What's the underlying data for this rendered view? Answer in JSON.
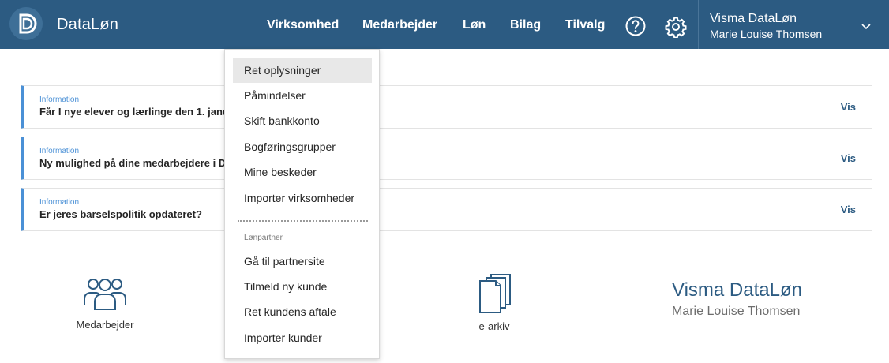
{
  "header": {
    "brand": "DataLøn",
    "nav": [
      "Virksomhed",
      "Medarbejder",
      "Løn",
      "Bilag",
      "Tilvalg"
    ],
    "help_icon": "question-circle-icon",
    "settings_icon": "gear-icon",
    "user": {
      "company": "Visma DataLøn",
      "name": "Marie Louise Thomsen",
      "chevron_icon": "chevron-down-icon"
    },
    "colors": {
      "bar": "#2c5b82",
      "text": "#ffffff"
    }
  },
  "info_cards": [
    {
      "kicker": "Information",
      "title": "Får I nye elever og lærlinge den 1. janu",
      "link": "Vis"
    },
    {
      "kicker": "Information",
      "title": "Ny mulighed på dine medarbejdere i D",
      "link": "Vis"
    },
    {
      "kicker": "Information",
      "title": "Er jeres barselspolitik opdateret?",
      "link": "Vis"
    }
  ],
  "tiles": {
    "employees": {
      "label": "Medarbejder",
      "icon": "users-icon"
    },
    "archive": {
      "label": "e-arkiv",
      "icon": "documents-icon"
    }
  },
  "footer": {
    "company": "Visma DataLøn",
    "name": "Marie Louise Thomsen"
  },
  "dropdown": {
    "items": [
      "Ret oplysninger",
      "Påmindelser",
      "Skift bankkonto",
      "Bogføringsgrupper",
      "Mine beskeder",
      "Importer virksomheder"
    ],
    "section_label": "Lønpartner",
    "partner_items": [
      "Gå til partnersite",
      "Tilmeld ny kunde",
      "Ret kundens aftale",
      "Importer kunder"
    ],
    "active_item": "Ret oplysninger"
  },
  "colors": {
    "accent": "#4a90d6",
    "primary": "#2c5b82"
  }
}
